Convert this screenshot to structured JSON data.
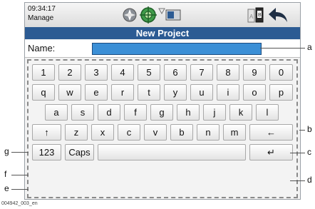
{
  "status_bar": {
    "time": "09:34:17",
    "app_label": "Manage",
    "icons": [
      "compass-icon",
      "target-icon",
      "signal-icon",
      "sim-card-icon",
      "battery-ab-icon",
      "back-arrow-icon"
    ]
  },
  "title": "New Project",
  "name_field": {
    "label": "Name:",
    "value": ""
  },
  "keyboard": {
    "row1": [
      "1",
      "2",
      "3",
      "4",
      "5",
      "6",
      "7",
      "8",
      "9",
      "0"
    ],
    "row2": [
      "q",
      "w",
      "e",
      "r",
      "t",
      "y",
      "u",
      "i",
      "o",
      "p"
    ],
    "row3": [
      "a",
      "s",
      "d",
      "f",
      "g",
      "h",
      "j",
      "k",
      "l"
    ],
    "row4": [
      "z",
      "x",
      "c",
      "v",
      "b",
      "n",
      "m"
    ],
    "shift_label": "↑",
    "backspace_label": "←",
    "numeric_label": "123",
    "caps_label": "Caps",
    "enter_label": "↵"
  },
  "callouts": {
    "a": "a",
    "b": "b",
    "c": "c",
    "d": "d",
    "e": "e",
    "f": "f",
    "g": "g"
  },
  "footer_code": "004942_003_en",
  "colors": {
    "title_bar": "#2c5b93",
    "name_field": "#3b8fd6"
  }
}
